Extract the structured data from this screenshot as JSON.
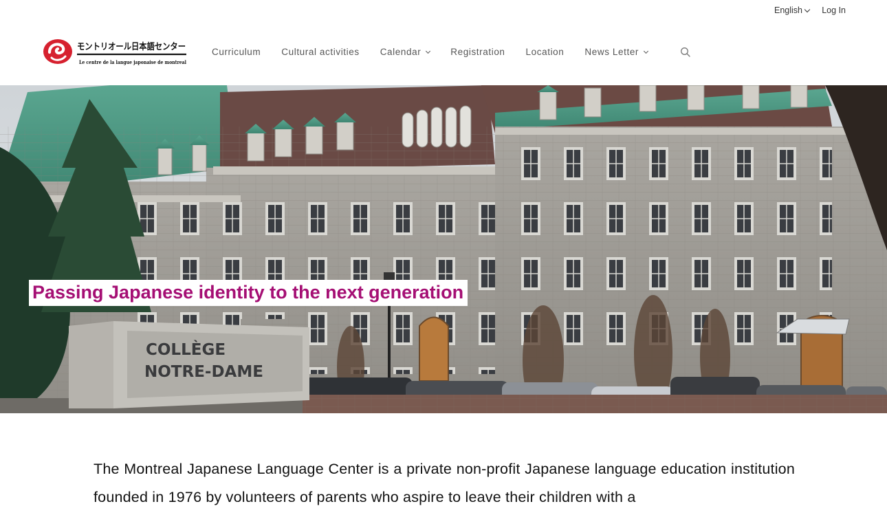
{
  "topbar": {
    "language": "English",
    "login": "Log In"
  },
  "logo": {
    "japanese_text": "モントリオール日本語センター",
    "subtitle": "Le centre de la langue japonaise de montreal"
  },
  "nav": {
    "items": [
      {
        "label": "Curriculum",
        "has_dropdown": false
      },
      {
        "label": "Cultural activities",
        "has_dropdown": false
      },
      {
        "label": "Calendar",
        "has_dropdown": true
      },
      {
        "label": "Registration",
        "has_dropdown": false
      },
      {
        "label": "Location",
        "has_dropdown": false
      },
      {
        "label": "News Letter",
        "has_dropdown": true
      }
    ],
    "search_icon": "search-icon"
  },
  "hero": {
    "tagline": "Passing Japanese identity to the next generation",
    "sign_line1": "COLLÈGE",
    "sign_line2": "NOTRE-DAME"
  },
  "intro": {
    "text": "The Montreal Japanese Language Center is a private non-profit Japanese language education institution founded in 1976 by volunteers of parents who aspire to leave their children with a"
  },
  "colors": {
    "accent": "#a50f74",
    "logo_red": "#d6212f",
    "roof_green": "#4f9a86",
    "stone": "#9a9791"
  }
}
